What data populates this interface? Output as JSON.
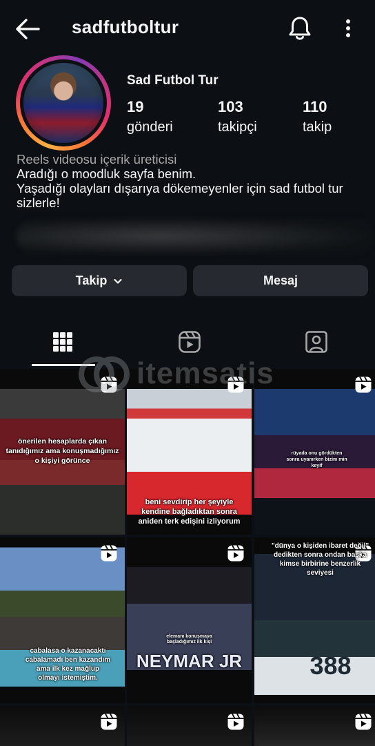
{
  "header": {
    "username": "sadfutboltur",
    "icons": {
      "back": "back-arrow-icon",
      "notifications": "bell-icon",
      "more": "more-vertical-icon"
    }
  },
  "profile": {
    "display_name": "Sad Futbol Tur",
    "stats": [
      {
        "value": "19",
        "label": "gönderi"
      },
      {
        "value": "103",
        "label": "takipçi"
      },
      {
        "value": "110",
        "label": "takip"
      }
    ],
    "category": "Reels videosu içerik üreticisi",
    "bio_lines": [
      "Aradığı o moodluk sayfa benim.",
      "Yaşadığı olayları dışarıya dökemeyenler için sad futbol tur sizlerle!"
    ]
  },
  "actions": {
    "follow_label": "Takip",
    "message_label": "Mesaj"
  },
  "tabs": [
    {
      "name": "grid",
      "icon": "grid-icon",
      "selected": true
    },
    {
      "name": "reels",
      "icon": "reels-icon",
      "selected": false
    },
    {
      "name": "tagged",
      "icon": "tagged-person-icon",
      "selected": false
    }
  ],
  "watermark": {
    "text": "itemsatis"
  },
  "posts": [
    {
      "caption": "önerilen hesaplarda çıkan tanıdığımız ama konuşmadığımız o kişiyi görünce",
      "type": "reel"
    },
    {
      "caption": "beni sevdirip her şeyiyle kendine bağladıktan sonra aniden terk edişini izliyorum",
      "type": "reel"
    },
    {
      "caption": "rüyada onu gördükten sonra uyanırken bizim min keyif",
      "type": "reel"
    },
    {
      "caption": "cabalasa o kazanacaktı cabalamadı ben kazandım ama ilk kez mağlup olmayı istemiştim.",
      "type": "reel"
    },
    {
      "caption": "elemanı konuşmaya başladığımız ilk kişi",
      "jersey": "NEYMAR JR",
      "type": "reel"
    },
    {
      "caption": "\"dünya o kişiden ibaret değil\" dedikten sonra ondan başka kimse birbirine benzerlik seviyesi",
      "jersey_number": "388",
      "type": "reel"
    },
    {
      "caption": "",
      "type": "reel"
    },
    {
      "caption": "",
      "type": "reel"
    },
    {
      "caption": "",
      "type": "reel"
    }
  ]
}
